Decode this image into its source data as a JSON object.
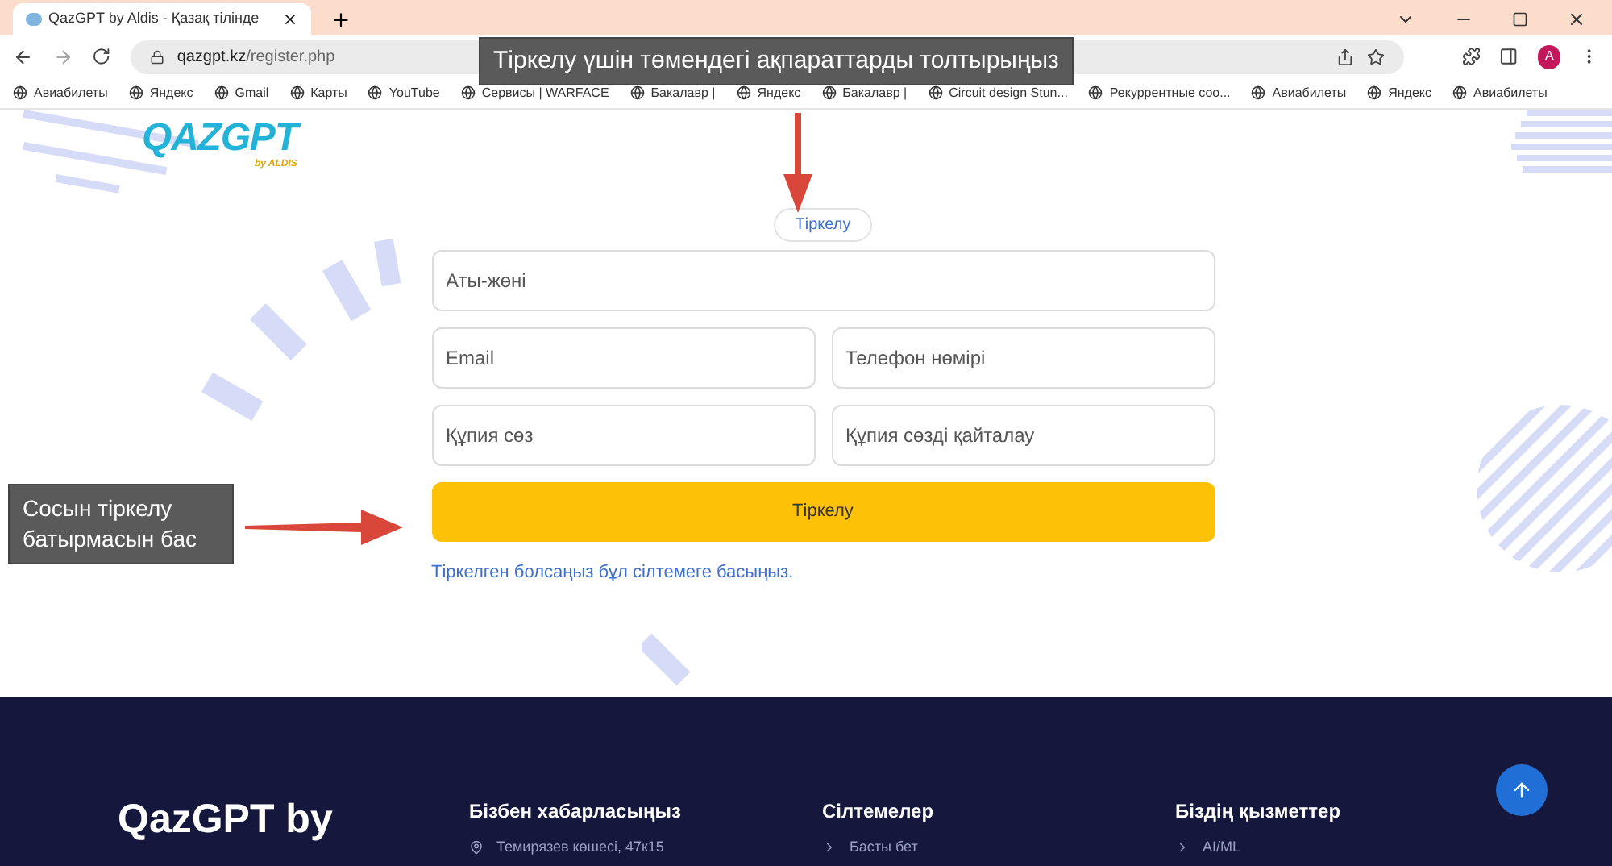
{
  "browser": {
    "tab_title": "QazGPT by Aldis - Қазақ тілінде",
    "url_host": "qazgpt.kz",
    "url_path": "/register.php",
    "bookmarks": [
      "Авиабилеты",
      "Яндекс",
      "Gmail",
      "Карты",
      "YouTube",
      "Сервисы | WARFACE",
      "Бакалавр |",
      "Яндекс",
      "Бакалавр |",
      "Circuit design Stun...",
      "Рекуррентные соо...",
      "Авиабилеты",
      "Яндекс",
      "Авиабилеты"
    ],
    "profile_initial": "A"
  },
  "annotations": [
    {
      "text": "Тіркелу үшін төмендегі ақпараттарды толтырыңыз"
    },
    {
      "text": "Сосын тіркелу батырмасын бас"
    }
  ],
  "page": {
    "logo": {
      "main": "QAZGPT",
      "sub": "by ALDIS"
    },
    "badge": "Тіркелу",
    "fields": [
      {
        "placeholder": "Аты-жөні"
      },
      {
        "placeholder": "Email"
      },
      {
        "placeholder": "Телефон нөмірі"
      },
      {
        "placeholder": "Құпия сөз"
      },
      {
        "placeholder": "Құпия сөзді қайталау"
      }
    ],
    "submit": "Тіркелу",
    "login_link": "Тіркелген болсаңыз бұл сілтемеге басыңыз."
  },
  "footer": {
    "brand": "QazGPT by",
    "columns": [
      {
        "title": "Бізбен хабарласыңыз",
        "item": "Темирязев көшесі, 47к15"
      },
      {
        "title": "Сілтемелер",
        "item": "Басты бет"
      },
      {
        "title": "Біздің қызметтер",
        "item": "AI/ML"
      }
    ]
  }
}
